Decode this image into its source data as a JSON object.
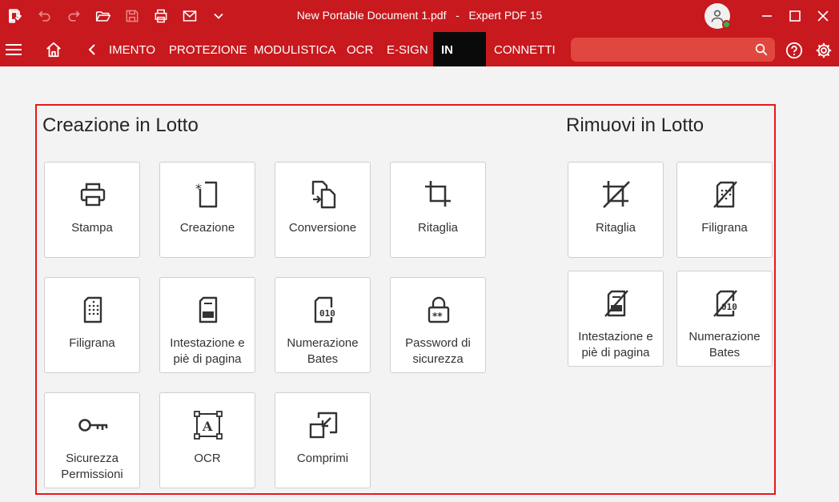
{
  "app": {
    "document_name": "New Portable Document 1.pdf",
    "separator": "-",
    "product": "Expert PDF 15"
  },
  "quick_access": [
    "app-logo-icon",
    "undo-icon",
    "redo-icon",
    "open-folder-icon",
    "save-icon",
    "print-icon",
    "email-icon",
    "chevron-down-icon"
  ],
  "tabs": [
    {
      "label": "IMENTO"
    },
    {
      "label": "PROTEZIONE"
    },
    {
      "label": "MODULISTICA"
    },
    {
      "label": "OCR"
    },
    {
      "label": "E-SIGN"
    },
    {
      "label": "IN"
    },
    {
      "label": "CONNETTI"
    }
  ],
  "search": {
    "placeholder": ""
  },
  "colors": {
    "brand": "#c8191e",
    "active_tab": "#0a0a0a",
    "highlight_border": "#e81818"
  },
  "batch_create": {
    "title": "Creazione in Lotto",
    "items": [
      {
        "label": "Stampa",
        "icon": "printer-icon"
      },
      {
        "label": "Creazione",
        "icon": "create-document-icon"
      },
      {
        "label": "Conversione",
        "icon": "convert-icon"
      },
      {
        "label": "Ritaglia",
        "icon": "crop-icon"
      },
      {
        "label": "Filigrana",
        "icon": "watermark-icon"
      },
      {
        "label": "Intestazione e piè di pagina",
        "icon": "header-footer-icon"
      },
      {
        "label": "Numerazione Bates",
        "icon": "bates-numbering-icon"
      },
      {
        "label": "Password di sicurezza",
        "icon": "lock-icon"
      },
      {
        "label": "Sicurezza Permissioni",
        "icon": "key-icon"
      },
      {
        "label": "OCR",
        "icon": "ocr-icon"
      },
      {
        "label": "Comprimi",
        "icon": "compress-icon"
      }
    ]
  },
  "batch_remove": {
    "title": "Rimuovi in Lotto",
    "items": [
      {
        "label": "Ritaglia",
        "icon": "remove-crop-icon"
      },
      {
        "label": "Filigrana",
        "icon": "remove-watermark-icon"
      },
      {
        "label": "Intestazione e piè di pagina",
        "icon": "remove-header-footer-icon"
      },
      {
        "label": "Numerazione Bates",
        "icon": "remove-bates-icon"
      }
    ]
  }
}
